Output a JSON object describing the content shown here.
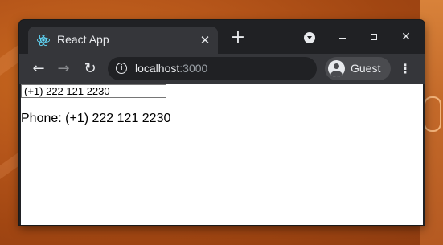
{
  "browser": {
    "tab": {
      "title": "React App",
      "close_glyph": "✕",
      "icon": "react-icon"
    },
    "new_tab_glyph": "+",
    "window_controls": {
      "close_glyph": "✕"
    },
    "toolbar": {
      "back_glyph": "←",
      "forward_glyph": "→",
      "reload_glyph": "↻",
      "info_glyph": "i",
      "url_host": "localhost",
      "url_port": ":3000",
      "profile_name": "Guest",
      "menu_glyph": "⋮"
    }
  },
  "page": {
    "phone_input_value": "(+1) 222 121 2230",
    "phone_output_text": "Phone: (+1) 222 121 2230"
  },
  "colors": {
    "titlebar": "#202124",
    "toolbar": "#35363a",
    "text": "#e8eaed",
    "desktop": "#b6561a"
  }
}
